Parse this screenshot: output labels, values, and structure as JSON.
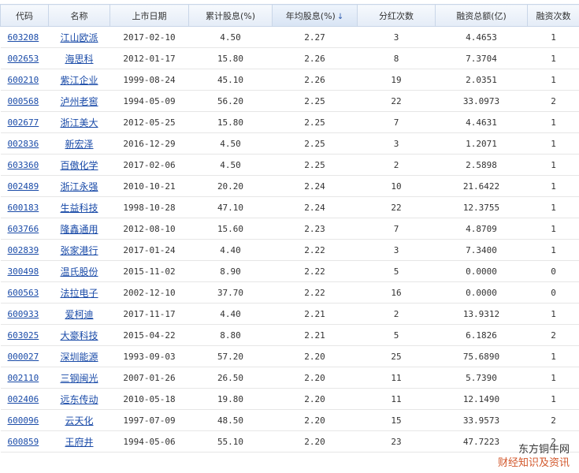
{
  "headers": {
    "code": "代码",
    "name": "名称",
    "list_date": "上市日期",
    "cum_dividend": "累计股息(%)",
    "avg_dividend": "年均股息(%)",
    "dividend_count": "分红次数",
    "financing_total": "融资总额(亿)",
    "financing_count": "融资次数"
  },
  "sort": {
    "column": "avg_dividend",
    "direction": "desc",
    "icon": "arrow-down-icon",
    "glyph": "↓"
  },
  "rows": [
    {
      "code": "603208",
      "name": "江山欧派",
      "list_date": "2017-02-10",
      "cum_dividend": "4.50",
      "avg_dividend": "2.27",
      "dividend_count": "3",
      "financing_total": "4.4653",
      "financing_count": "1"
    },
    {
      "code": "002653",
      "name": "海思科",
      "list_date": "2012-01-17",
      "cum_dividend": "15.80",
      "avg_dividend": "2.26",
      "dividend_count": "8",
      "financing_total": "7.3704",
      "financing_count": "1"
    },
    {
      "code": "600210",
      "name": "紫江企业",
      "list_date": "1999-08-24",
      "cum_dividend": "45.10",
      "avg_dividend": "2.26",
      "dividend_count": "19",
      "financing_total": "2.0351",
      "financing_count": "1"
    },
    {
      "code": "000568",
      "name": "泸州老窖",
      "list_date": "1994-05-09",
      "cum_dividend": "56.20",
      "avg_dividend": "2.25",
      "dividend_count": "22",
      "financing_total": "33.0973",
      "financing_count": "2"
    },
    {
      "code": "002677",
      "name": "浙江美大",
      "list_date": "2012-05-25",
      "cum_dividend": "15.80",
      "avg_dividend": "2.25",
      "dividend_count": "7",
      "financing_total": "4.4631",
      "financing_count": "1"
    },
    {
      "code": "002836",
      "name": "新宏泽",
      "list_date": "2016-12-29",
      "cum_dividend": "4.50",
      "avg_dividend": "2.25",
      "dividend_count": "3",
      "financing_total": "1.2071",
      "financing_count": "1"
    },
    {
      "code": "603360",
      "name": "百傲化学",
      "list_date": "2017-02-06",
      "cum_dividend": "4.50",
      "avg_dividend": "2.25",
      "dividend_count": "2",
      "financing_total": "2.5898",
      "financing_count": "1"
    },
    {
      "code": "002489",
      "name": "浙江永强",
      "list_date": "2010-10-21",
      "cum_dividend": "20.20",
      "avg_dividend": "2.24",
      "dividend_count": "10",
      "financing_total": "21.6422",
      "financing_count": "1"
    },
    {
      "code": "600183",
      "name": "生益科技",
      "list_date": "1998-10-28",
      "cum_dividend": "47.10",
      "avg_dividend": "2.24",
      "dividend_count": "22",
      "financing_total": "12.3755",
      "financing_count": "1"
    },
    {
      "code": "603766",
      "name": "隆鑫通用",
      "list_date": "2012-08-10",
      "cum_dividend": "15.60",
      "avg_dividend": "2.23",
      "dividend_count": "7",
      "financing_total": "4.8709",
      "financing_count": "1"
    },
    {
      "code": "002839",
      "name": "张家港行",
      "list_date": "2017-01-24",
      "cum_dividend": "4.40",
      "avg_dividend": "2.22",
      "dividend_count": "3",
      "financing_total": "7.3400",
      "financing_count": "1"
    },
    {
      "code": "300498",
      "name": "温氏股份",
      "list_date": "2015-11-02",
      "cum_dividend": "8.90",
      "avg_dividend": "2.22",
      "dividend_count": "5",
      "financing_total": "0.0000",
      "financing_count": "0"
    },
    {
      "code": "600563",
      "name": "法拉电子",
      "list_date": "2002-12-10",
      "cum_dividend": "37.70",
      "avg_dividend": "2.22",
      "dividend_count": "16",
      "financing_total": "0.0000",
      "financing_count": "0"
    },
    {
      "code": "600933",
      "name": "爱柯迪",
      "list_date": "2017-11-17",
      "cum_dividend": "4.40",
      "avg_dividend": "2.21",
      "dividend_count": "2",
      "financing_total": "13.9312",
      "financing_count": "1"
    },
    {
      "code": "603025",
      "name": "大豪科技",
      "list_date": "2015-04-22",
      "cum_dividend": "8.80",
      "avg_dividend": "2.21",
      "dividend_count": "5",
      "financing_total": "6.1826",
      "financing_count": "2"
    },
    {
      "code": "000027",
      "name": "深圳能源",
      "list_date": "1993-09-03",
      "cum_dividend": "57.20",
      "avg_dividend": "2.20",
      "dividend_count": "25",
      "financing_total": "75.6890",
      "financing_count": "1"
    },
    {
      "code": "002110",
      "name": "三钢闽光",
      "list_date": "2007-01-26",
      "cum_dividend": "26.50",
      "avg_dividend": "2.20",
      "dividend_count": "11",
      "financing_total": "5.7390",
      "financing_count": "1"
    },
    {
      "code": "002406",
      "name": "远东传动",
      "list_date": "2010-05-18",
      "cum_dividend": "19.80",
      "avg_dividend": "2.20",
      "dividend_count": "11",
      "financing_total": "12.1490",
      "financing_count": "1"
    },
    {
      "code": "600096",
      "name": "云天化",
      "list_date": "1997-07-09",
      "cum_dividend": "48.50",
      "avg_dividend": "2.20",
      "dividend_count": "15",
      "financing_total": "33.9573",
      "financing_count": "2"
    },
    {
      "code": "600859",
      "name": "王府井",
      "list_date": "1994-05-06",
      "cum_dividend": "55.10",
      "avg_dividend": "2.20",
      "dividend_count": "23",
      "financing_total": "47.7223",
      "financing_count": "2"
    }
  ],
  "watermark": {
    "line1": "东方铜牛网",
    "line2": "财经知识及资讯"
  }
}
